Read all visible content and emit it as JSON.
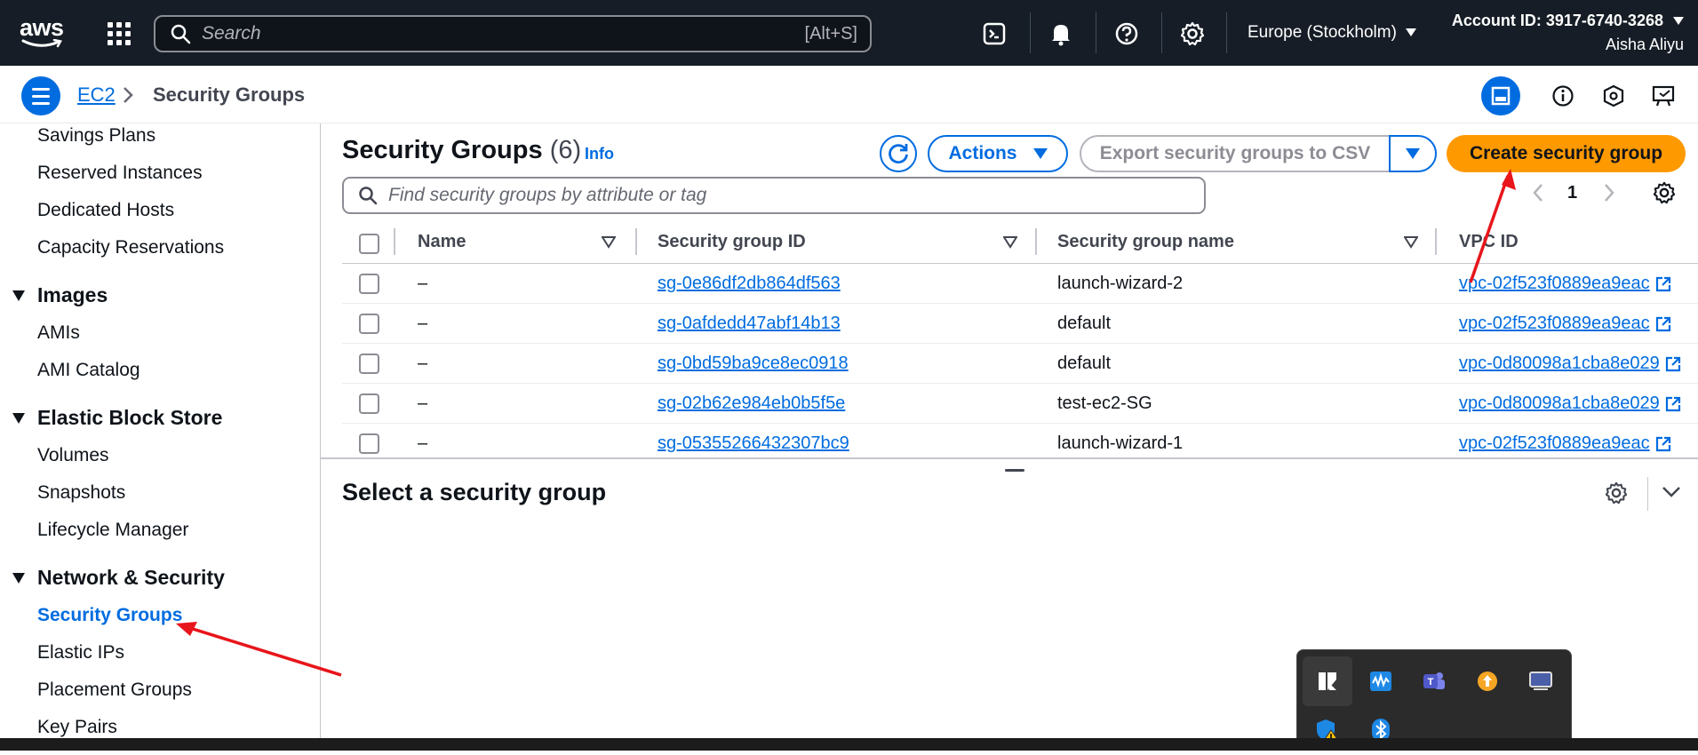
{
  "topnav": {
    "logo_text": "aws",
    "search_placeholder": "Search",
    "search_shortcut": "[Alt+S]",
    "region": "Europe (Stockholm)",
    "account_id": "Account ID: 3917-6740-3268",
    "user_name": "Aisha Aliyu"
  },
  "breadcrumb": {
    "parent": "EC2",
    "current": "Security Groups"
  },
  "sidebar": {
    "items_top": [
      "Savings Plans",
      "Reserved Instances",
      "Dedicated Hosts",
      "Capacity Reservations"
    ],
    "sections": [
      {
        "title": "Images",
        "items": [
          "AMIs",
          "AMI Catalog"
        ]
      },
      {
        "title": "Elastic Block Store",
        "items": [
          "Volumes",
          "Snapshots",
          "Lifecycle Manager"
        ]
      },
      {
        "title": "Network & Security",
        "items": [
          "Security Groups",
          "Elastic IPs",
          "Placement Groups",
          "Key Pairs"
        ]
      }
    ],
    "active_item": "Security Groups"
  },
  "main": {
    "title": "Security Groups",
    "count": "(6)",
    "info_label": "Info",
    "actions_label": "Actions",
    "export_label": "Export security groups to CSV",
    "create_label": "Create security group",
    "filter_placeholder": "Find security groups by attribute or tag",
    "page_number": "1",
    "columns": [
      "Name",
      "Security group ID",
      "Security group name",
      "VPC ID"
    ],
    "rows": [
      {
        "name": "–",
        "sg_id": "sg-0e86df2db864df563",
        "sg_name": "launch-wizard-2",
        "vpc_id": "vpc-02f523f0889ea9eac"
      },
      {
        "name": "–",
        "sg_id": "sg-0afdedd47abf14b13",
        "sg_name": "default",
        "vpc_id": "vpc-02f523f0889ea9eac"
      },
      {
        "name": "–",
        "sg_id": "sg-0bd59ba9ce8ec0918",
        "sg_name": "default",
        "vpc_id": "vpc-0d80098a1cba8e029"
      },
      {
        "name": "–",
        "sg_id": "sg-02b62e984eb0b5f5e",
        "sg_name": "test-ec2-SG",
        "vpc_id": "vpc-0d80098a1cba8e029"
      },
      {
        "name": "–",
        "sg_id": "sg-05355266432307bc9",
        "sg_name": "launch-wizard-1",
        "vpc_id": "vpc-02f523f0889ea9eac"
      }
    ],
    "detail_title": "Select a security group"
  },
  "colors": {
    "nav_bg": "#161d26",
    "accent_blue": "#006ce0",
    "primary_orange": "#ff9900",
    "annotation_red": "#e8151b"
  },
  "tray_icons": [
    "windows-app-icon",
    "waveform-app-icon",
    "teams-icon",
    "orange-update-icon",
    "display-icon",
    "defender-warning-icon",
    "bluetooth-icon"
  ]
}
